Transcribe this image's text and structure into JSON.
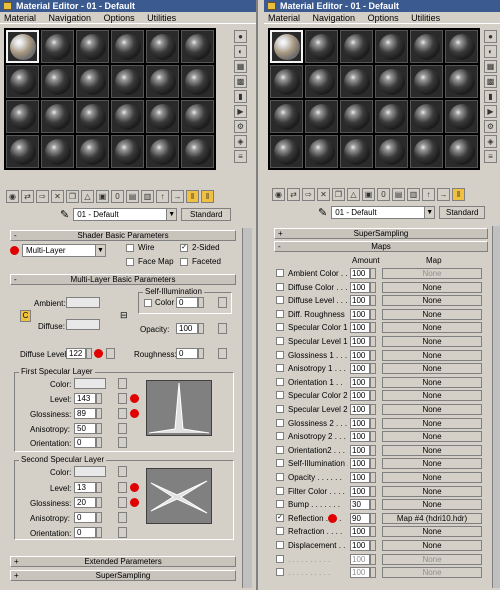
{
  "left_window": {
    "title": "Material Editor - 01 - Default",
    "menu": [
      "Material",
      "Navigation",
      "Options",
      "Utilities"
    ]
  },
  "right_window": {
    "title": "Material Editor - 01 - Default",
    "menu": [
      "Material",
      "Navigation",
      "Options",
      "Utilities"
    ]
  },
  "material_name": "01 - Default",
  "material_type_button": "Standard",
  "shader_basic": {
    "header": "Shader Basic Parameters",
    "shader": "Multi-Layer",
    "wire": "Wire",
    "two_sided": "2-Sided",
    "two_sided_checked": true,
    "face_map": "Face Map",
    "faceted": "Faceted"
  },
  "multi_layer_basic": {
    "header": "Multi-Layer Basic Parameters",
    "self_illum_group": "Self-Illumination",
    "color_label": "Color",
    "self_illum_value": "0",
    "ambient_label": "Ambient:",
    "diffuse_label": "Diffuse:",
    "opacity_label": "Opacity:",
    "opacity_value": "100",
    "diffuse_level_label": "Diffuse Level:",
    "diffuse_level_value": "122",
    "roughness_label": "Roughness:",
    "roughness_value": "0",
    "lock_c": "C"
  },
  "first_specular": {
    "group": "First Specular Layer",
    "color_label": "Color:",
    "level_label": "Level:",
    "level_value": "143",
    "gloss_label": "Glossiness:",
    "gloss_value": "89",
    "aniso_label": "Anisotropy:",
    "aniso_value": "50",
    "orient_label": "Orientation:",
    "orient_value": "0"
  },
  "second_specular": {
    "group": "Second Specular Layer",
    "color_label": "Color:",
    "level_label": "Level:",
    "level_value": "13",
    "gloss_label": "Glossiness:",
    "gloss_value": "20",
    "aniso_label": "Anisotropy:",
    "aniso_value": "0",
    "orient_label": "Orientation:",
    "orient_value": "0"
  },
  "left_rollouts": {
    "extended": "Extended Parameters",
    "supersampling": "SuperSampling"
  },
  "right_rollouts": {
    "supersampling": "SuperSampling",
    "maps": "Maps"
  },
  "maps_header": {
    "amount": "Amount",
    "map": "Map"
  },
  "maps": [
    {
      "name": "Ambient Color . .",
      "amount": "100",
      "map": "None",
      "checked": false,
      "dim": false,
      "map_dim": true
    },
    {
      "name": "Diffuse Color . . .",
      "amount": "100",
      "map": "None",
      "checked": false,
      "dim": false,
      "map_dim": false
    },
    {
      "name": "Diffuse Level . . .",
      "amount": "100",
      "map": "None",
      "checked": false,
      "dim": false,
      "map_dim": false
    },
    {
      "name": "Diff. Roughness",
      "amount": "100",
      "map": "None",
      "checked": false,
      "dim": false,
      "map_dim": false
    },
    {
      "name": "Specular Color 1",
      "amount": "100",
      "map": "None",
      "checked": false,
      "dim": false,
      "map_dim": false
    },
    {
      "name": "Specular Level 1",
      "amount": "100",
      "map": "None",
      "checked": false,
      "dim": false,
      "map_dim": false
    },
    {
      "name": "Glossiness 1 . . .",
      "amount": "100",
      "map": "None",
      "checked": false,
      "dim": false,
      "map_dim": false
    },
    {
      "name": "Anisotropy 1 . . .",
      "amount": "100",
      "map": "None",
      "checked": false,
      "dim": false,
      "map_dim": false
    },
    {
      "name": "Orientation 1 . .",
      "amount": "100",
      "map": "None",
      "checked": false,
      "dim": false,
      "map_dim": false
    },
    {
      "name": "Specular Color 2",
      "amount": "100",
      "map": "None",
      "checked": false,
      "dim": false,
      "map_dim": false
    },
    {
      "name": "Specular Level 2",
      "amount": "100",
      "map": "None",
      "checked": false,
      "dim": false,
      "map_dim": false
    },
    {
      "name": "Glossiness 2 . . .",
      "amount": "100",
      "map": "None",
      "checked": false,
      "dim": false,
      "map_dim": false
    },
    {
      "name": "Anisotropy 2 . . .",
      "amount": "100",
      "map": "None",
      "checked": false,
      "dim": false,
      "map_dim": false
    },
    {
      "name": "Orientation2 . . .",
      "amount": "100",
      "map": "None",
      "checked": false,
      "dim": false,
      "map_dim": false
    },
    {
      "name": "Self-Illumination .",
      "amount": "100",
      "map": "None",
      "checked": false,
      "dim": false,
      "map_dim": false
    },
    {
      "name": "Opacity . . . . . .",
      "amount": "100",
      "map": "None",
      "checked": false,
      "dim": false,
      "map_dim": false
    },
    {
      "name": "Filter Color . . . .",
      "amount": "100",
      "map": "None",
      "checked": false,
      "dim": false,
      "map_dim": false
    },
    {
      "name": "Bump . . . . . . .",
      "amount": "30",
      "map": "None",
      "checked": false,
      "dim": false,
      "map_dim": false
    },
    {
      "name": "Reflection . . . .",
      "amount": "90",
      "map": "Map #4 (hdri10.hdr)",
      "checked": true,
      "dim": false,
      "map_dim": false
    },
    {
      "name": "Refraction . . . .",
      "amount": "100",
      "map": "None",
      "checked": false,
      "dim": false,
      "map_dim": false
    },
    {
      "name": "Displacement . . .",
      "amount": "100",
      "map": "None",
      "checked": false,
      "dim": false,
      "map_dim": false
    },
    {
      "name": ". . . . . . . . . .",
      "amount": "100",
      "map": "None",
      "checked": false,
      "dim": true,
      "map_dim": true
    },
    {
      "name": ". . . . . . . . . .",
      "amount": "100",
      "map": "None",
      "checked": false,
      "dim": true,
      "map_dim": true
    }
  ]
}
